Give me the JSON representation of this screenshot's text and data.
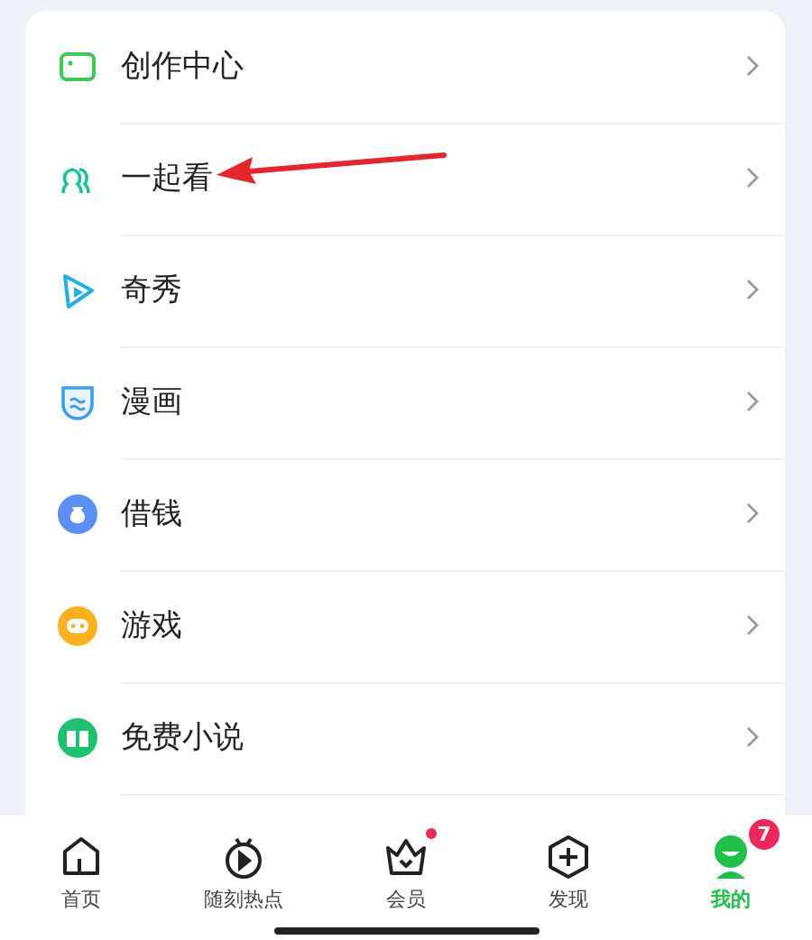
{
  "menu_items": [
    {
      "kind": "creator",
      "label": "创作中心",
      "arrow_annotation": false
    },
    {
      "kind": "together",
      "label": "一起看",
      "arrow_annotation": true
    },
    {
      "kind": "qixiu",
      "label": "奇秀"
    },
    {
      "kind": "comic",
      "label": "漫画"
    },
    {
      "kind": "loan",
      "label": "借钱"
    },
    {
      "kind": "game",
      "label": "游戏"
    },
    {
      "kind": "novel",
      "label": "免费小说"
    }
  ],
  "tabs": [
    {
      "kind": "home",
      "label": "首页",
      "selected": false
    },
    {
      "kind": "hot",
      "label": "随刻热点",
      "selected": false
    },
    {
      "kind": "vip",
      "label": "会员",
      "selected": false,
      "notification_dot": true
    },
    {
      "kind": "discover",
      "label": "发现",
      "selected": false
    },
    {
      "kind": "me",
      "label": "我的",
      "selected": true,
      "badge": "7"
    }
  ]
}
